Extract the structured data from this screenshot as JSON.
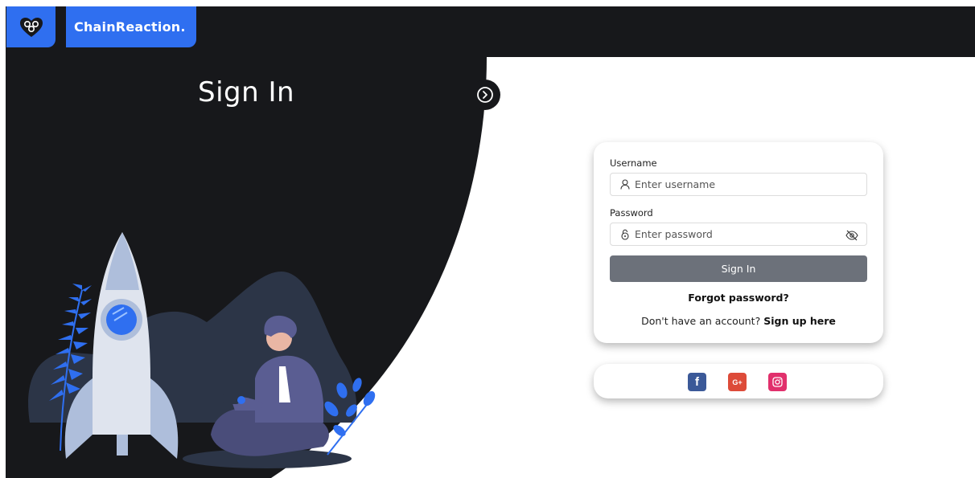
{
  "brand": {
    "name": "ChainReaction."
  },
  "panel": {
    "title": "Sign In"
  },
  "form": {
    "username_label": "Username",
    "username_placeholder": "Enter username",
    "password_label": "Password",
    "password_placeholder": "Enter password",
    "submit_label": "Sign In",
    "forgot_label": "Forgot password?",
    "signup_prompt": "Don't have an account?",
    "signup_link": "Sign up here"
  },
  "social": {
    "facebook_glyph": "f",
    "google_glyph": "G+",
    "facebook_color": "#3b5998",
    "google_color": "#dd4b39",
    "instagram_color": "#e1306c"
  },
  "colors": {
    "dark": "#17181b",
    "accent": "#2f6ff0",
    "button": "#6c717a"
  }
}
